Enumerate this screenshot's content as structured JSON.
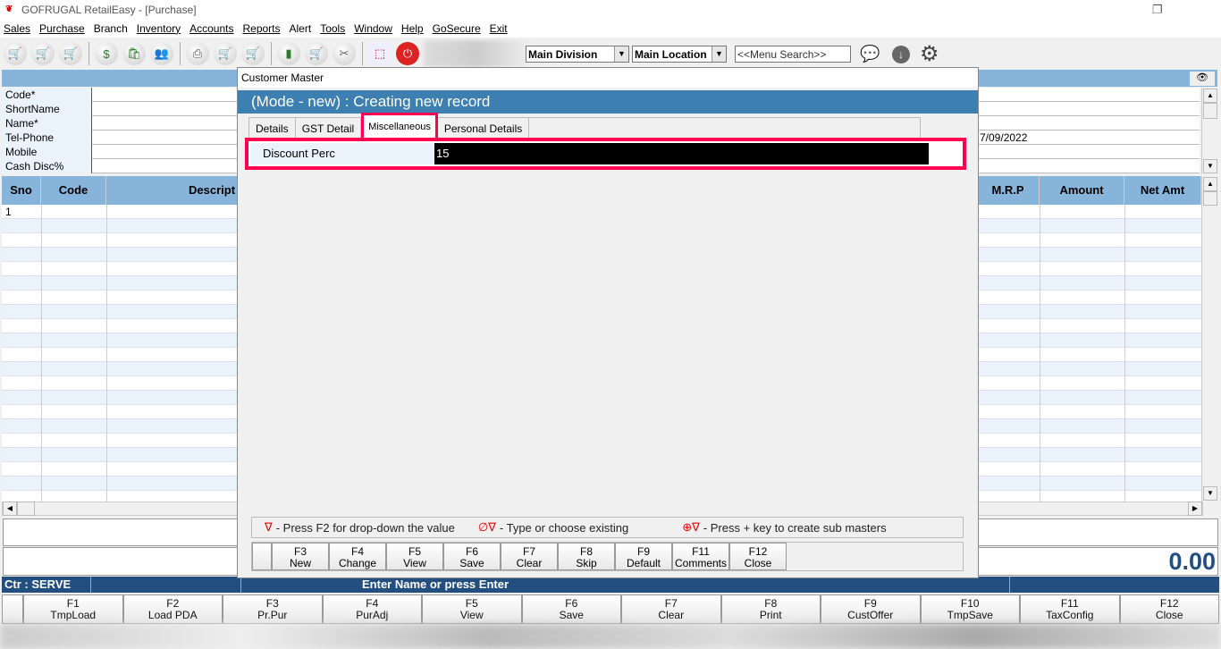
{
  "window": {
    "title": "GOFRUGAL RetailEasy - [Purchase]",
    "restore_icon": "restore-icon"
  },
  "menu": [
    "Sales",
    "Purchase",
    "Branch",
    "Inventory",
    "Accounts",
    "Reports",
    "Alert",
    "Tools",
    "Window",
    "Help",
    "GoSecure",
    "Exit"
  ],
  "toolbar": {
    "division": "Main Division",
    "location": "Main Location",
    "menu_search": "<<Menu Search>>"
  },
  "form": {
    "labels": [
      "Code*",
      "ShortName",
      "Name*",
      "Tel-Phone",
      "Mobile",
      "Cash Disc%"
    ],
    "date_value": "7/09/2022"
  },
  "grid": {
    "columns": [
      "Sno",
      "Code",
      "Descript",
      "M.R.P",
      "Amount",
      "Net Amt"
    ],
    "first_row_sno": "1"
  },
  "total": "0.00",
  "status": {
    "counter": "Ctr : SERVE",
    "message": "Enter Name or press Enter"
  },
  "fkeys": [
    {
      "k": "F1",
      "l": "TmpLoad"
    },
    {
      "k": "F2",
      "l": "Load PDA"
    },
    {
      "k": "F3",
      "l": "Pr.Pur"
    },
    {
      "k": "F4",
      "l": "PurAdj"
    },
    {
      "k": "F5",
      "l": "View"
    },
    {
      "k": "F6",
      "l": "Save"
    },
    {
      "k": "F7",
      "l": "Clear"
    },
    {
      "k": "F8",
      "l": "Print"
    },
    {
      "k": "F9",
      "l": "CustOffer"
    },
    {
      "k": "F10",
      "l": "TmpSave"
    },
    {
      "k": "F11",
      "l": "TaxConfig"
    },
    {
      "k": "F12",
      "l": "Close"
    }
  ],
  "dialog": {
    "title": "Customer Master",
    "mode": "(Mode - new) : Creating new record",
    "tabs": [
      "Details",
      "GST Detail",
      "Miscellaneous",
      "Personal Details"
    ],
    "field_label": "Discount Perc",
    "field_value": "15",
    "legend": [
      {
        "sym": "∇",
        "text": "- Press F2 for drop-down the value"
      },
      {
        "sym": "∅∇",
        "text": "- Type or choose existing"
      },
      {
        "sym": "⊕∇",
        "text": "- Press + key to create sub masters"
      }
    ],
    "buttons": [
      {
        "k": "F3",
        "l": "New"
      },
      {
        "k": "F4",
        "l": "Change"
      },
      {
        "k": "F5",
        "l": "View"
      },
      {
        "k": "F6",
        "l": "Save"
      },
      {
        "k": "F7",
        "l": "Clear"
      },
      {
        "k": "F8",
        "l": "Skip"
      },
      {
        "k": "F9",
        "l": "Default"
      },
      {
        "k": "F11",
        "l": "Comments"
      },
      {
        "k": "F12",
        "l": "Close"
      }
    ]
  }
}
